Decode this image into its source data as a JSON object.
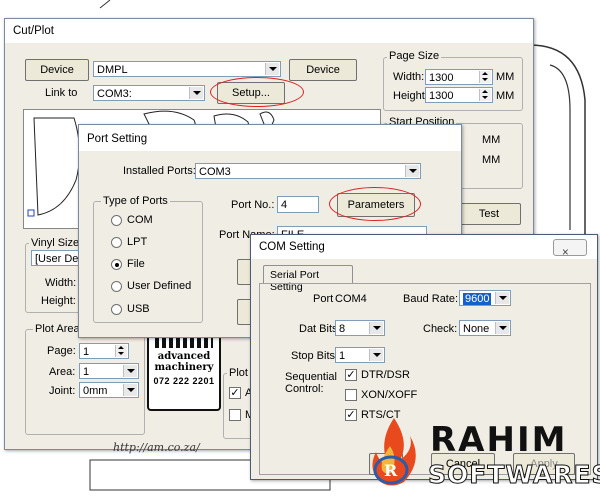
{
  "cutplot": {
    "title": "Cut/Plot",
    "close_glyph": "×",
    "device_button_left": "Device",
    "device_value": "DMPL",
    "device_button_right": "Device",
    "link_label": "Link to",
    "link_value": "COM3:",
    "setup_button": "Setup...",
    "page_size_legend": "Page Size",
    "width_label": "Width:",
    "width_value": "1300",
    "height_label": "Height",
    "height_value": "1300",
    "unit_mm": "MM",
    "start_pos_legend": "Start Position",
    "start_unit_1": "MM",
    "start_unit_2": "MM",
    "test_button": "Test",
    "vinyl_size_legend": "Vinyl Size",
    "vinyl_value": "[User De",
    "vinyl_width_label": "Width:",
    "vinyl_height_label": "Height:",
    "plot_area_legend": "Plot Area:",
    "page_label": "Page:",
    "page_value": "1",
    "area_label": "Area:",
    "area_value": "1",
    "joint_label": "Joint:",
    "joint_value": "0mm",
    "plot_b_legend": "Plot b",
    "check_a": "A",
    "check_m": "M",
    "logo_line1": "advanced",
    "logo_line2": "machinery",
    "logo_line3": "072 222 2201",
    "url_text": "http://am.co.za/"
  },
  "port": {
    "title": "Port Setting",
    "installed_label": "Installed Ports:",
    "installed_value": "COM3",
    "type_legend": "Type of Ports",
    "types": [
      "COM",
      "LPT",
      "File",
      "User Defined",
      "USB"
    ],
    "selected_type": "File",
    "port_no_label": "Port No.:",
    "port_no_value": "4",
    "parameters_button": "Parameters",
    "port_name_label": "Port Name:",
    "port_name_value": "FILE"
  },
  "com": {
    "title": "COM Setting",
    "close_glyph": "×",
    "tab_label": "Serial Port Setting",
    "port_label": "Port",
    "port_value": "COM4",
    "baud_label": "Baud Rate:",
    "baud_value": "9600",
    "dat_bits_label": "Dat Bits:",
    "dat_bits_value": "8",
    "check_label": "Check:",
    "check_value": "None",
    "stop_bits_label": "Stop Bits:",
    "stop_bits_value": "1",
    "seq_label_1": "Sequential",
    "seq_label_2": "Control:",
    "options": [
      {
        "label": "DTR/DSR",
        "checked": true
      },
      {
        "label": "XON/XOFF",
        "checked": false
      },
      {
        "label": "RTS/CT",
        "checked": true
      }
    ],
    "ok_button": "OK",
    "cancel_button": "Cancel",
    "apply_button": "Apply"
  },
  "watermark": {
    "line1": "RAHIM",
    "line2": "SOFTWARES"
  },
  "colors": {
    "highlight": "#1560c8",
    "ellipse": "#e02020"
  }
}
